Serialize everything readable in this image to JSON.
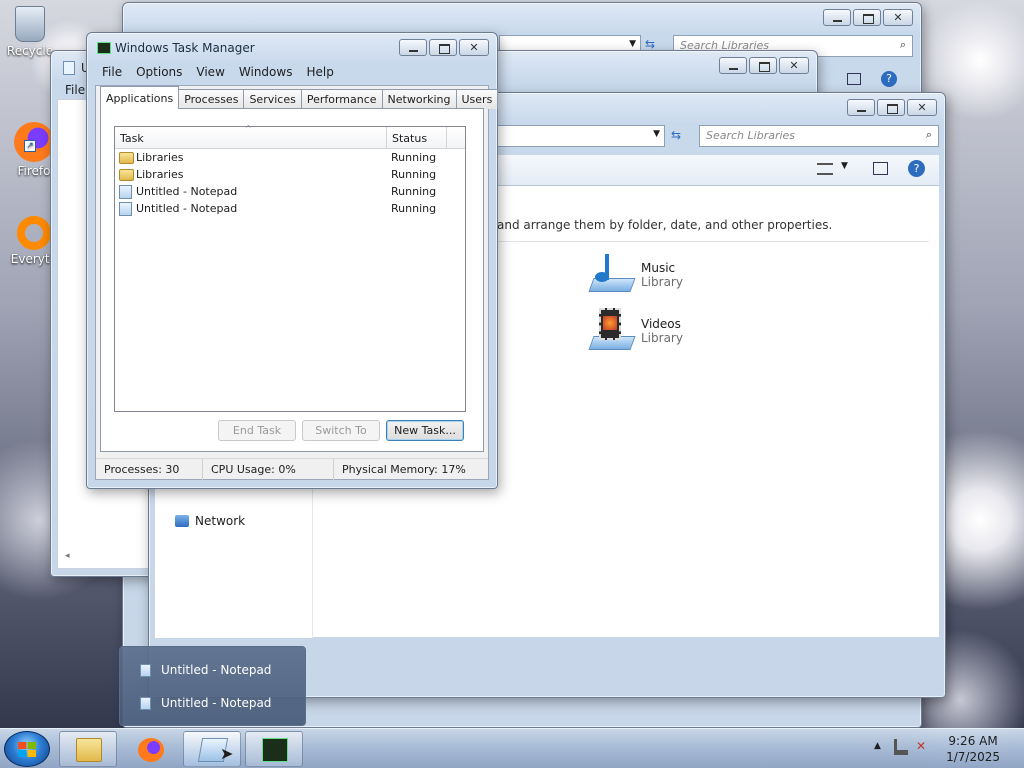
{
  "desktop": {
    "icons": [
      {
        "label": "Recycle",
        "icon": "recycle-bin-icon"
      },
      {
        "label": "Firefo",
        "icon": "firefox-icon"
      },
      {
        "label": "Everyth",
        "icon": "everything-search-icon"
      }
    ]
  },
  "explorer_back": {
    "search_placeholder": "Search Libraries"
  },
  "explorer_mid": {
    "menu_file": "File",
    "title_fragment": "U"
  },
  "explorer_front": {
    "search_placeholder": "Search Libraries",
    "description": "and arrange them by folder, date, and other properties.",
    "libraries": [
      {
        "title": "Music",
        "subtitle": "Library"
      },
      {
        "title": "Videos",
        "subtitle": "Library"
      }
    ],
    "nav_network": "Network"
  },
  "task_manager": {
    "title": "Windows Task Manager",
    "menu": [
      "File",
      "Options",
      "View",
      "Windows",
      "Help"
    ],
    "tabs": [
      "Applications",
      "Processes",
      "Services",
      "Performance",
      "Networking",
      "Users"
    ],
    "active_tab": "Applications",
    "columns": [
      "Task",
      "Status"
    ],
    "rows": [
      {
        "task": "Libraries",
        "status": "Running",
        "icon": "folder-icon"
      },
      {
        "task": "Libraries",
        "status": "Running",
        "icon": "folder-icon"
      },
      {
        "task": "Untitled - Notepad",
        "status": "Running",
        "icon": "notepad-icon"
      },
      {
        "task": "Untitled - Notepad",
        "status": "Running",
        "icon": "notepad-icon"
      }
    ],
    "buttons": {
      "end_task": "End Task",
      "switch_to": "Switch To",
      "new_task": "New Task..."
    },
    "status": {
      "processes": "Processes: 30",
      "cpu": "CPU Usage: 0%",
      "memory": "Physical Memory: 17%"
    }
  },
  "taskbar_popup": {
    "items": [
      "Untitled - Notepad",
      "Untitled - Notepad"
    ]
  },
  "taskbar": {
    "clock_time": "9:26 AM",
    "clock_date": "1/7/2025"
  },
  "colors": {
    "accent": "#3c7fb1",
    "taskbar": "#b0c4de"
  }
}
